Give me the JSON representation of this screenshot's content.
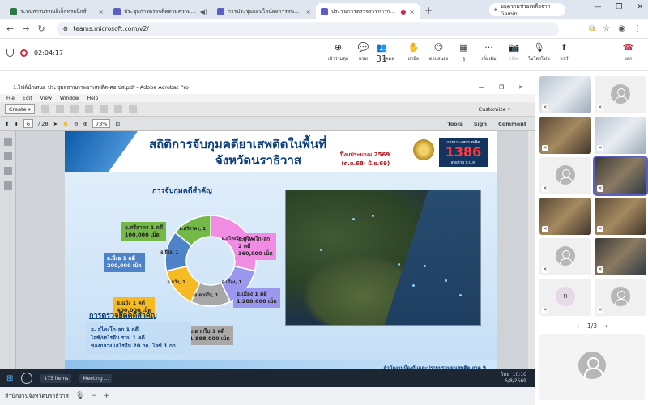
{
  "browser": {
    "tabs": [
      {
        "title": "ระบบสารบรรณอิเล็กทรอนิกส์",
        "color": "#2c7a3f"
      },
      {
        "title": "ประชุมการตรวจติดตามความก้าวหน้า",
        "color": "#5b5fc7"
      },
      {
        "title": "การประชุมออนไลน์ผลการสนทนาฯ",
        "color": "#5b5fc7"
      },
      {
        "title": "ประชุมการตรวจราชการกรมสอบสวน",
        "color": "#5b5fc7"
      }
    ],
    "new_tab_label": "+",
    "gemini_label": "ขอความช่วยเหลือจาก Gemini",
    "url": "teams.microsoft.com/v2/"
  },
  "teams": {
    "timer": "02:04:17",
    "controls": [
      {
        "label": "เข้าร่วมคุย",
        "icon": "⊕",
        "name": "join-chat"
      },
      {
        "label": "แชท",
        "icon": "💬",
        "name": "chat"
      },
      {
        "label": "บุคคล",
        "icon": "👥 31",
        "name": "people"
      },
      {
        "label": "ยกมือ",
        "icon": "✋",
        "name": "raise-hand"
      },
      {
        "label": "ตอบสนอง",
        "icon": "☺",
        "name": "react"
      },
      {
        "label": "ดู",
        "icon": "▦",
        "name": "view"
      },
      {
        "label": "เพิ่มเติม",
        "icon": "···",
        "name": "more"
      },
      {
        "label": "กล้อง",
        "icon": "📷",
        "name": "camera"
      },
      {
        "label": "ไมโครโฟน",
        "icon": "🎙",
        "name": "mic"
      },
      {
        "label": "แชร์",
        "icon": "⬆",
        "name": "share"
      }
    ],
    "leave_label": "ออก",
    "page_indicator": "1/3",
    "tile_letter": "n"
  },
  "acrobat": {
    "window_title": "1.ไฟล์นำเสนอ ประชุมสถานภาพยาเสพติด-ศอ.ปส.pdf - Adobe Acrobat Pro",
    "menu": [
      "File",
      "Edit",
      "View",
      "Window",
      "Help"
    ],
    "create_label": "Create",
    "customize_label": "Customize",
    "page_current": "6",
    "page_total": "/ 28",
    "zoom": "73%",
    "panel_links": [
      "Tools",
      "Sign",
      "Comment"
    ]
  },
  "slide": {
    "title_line1": "สถิติการจับกุมคดียาเสพติดในพื้นที่",
    "title_line2": "จังหวัดนราธิวาส",
    "fiscal_year": "ปีงบประมาณ 2569",
    "fiscal_range": "(ต.ค.68- มิ.ย.69)",
    "hotline_top": "แจ้งเบาะแสยาเสพติด",
    "hotline_number": "1386",
    "hotline_bottom": "สายด่วน ป.ป.ส.",
    "section_arrests": "การจับกุมคดีสำคัญ",
    "section_seizure": "การตรวจยึดคดีสำคัญ",
    "seizure_lines": [
      "อ. สุไหงโก-ลก 1 คดี",
      "ไอซ์/เฮโรอีน รวม 1 คดี",
      "ของกลาง เฮโรอีน 20 กก. ไอซ์ 1 กก."
    ],
    "footer": "สำนักงานป้องกันและปราบปรามยาเสพติด ภาค 9"
  },
  "chart_data": {
    "type": "pie",
    "variant": "donut",
    "title": "การจับกุมคดีสำคัญ",
    "categories": [
      "อ.สุไหงโก-ลก",
      "อ.เมือง",
      "อ.ตากใบ",
      "อ.แว้ง",
      "อ.ยี่งอ",
      "อ.ศรีสาคร"
    ],
    "values": [
      2,
      1,
      1,
      1,
      1,
      1
    ],
    "segment_labels": [
      "อ.สุไหงโก-ลก, 2",
      "อ.เมือง, 1",
      "อ.ตากใบ, 1",
      "อ.แว้ง, 1",
      "อ.ยี่งอ, 1",
      "อ.ศรีสาคร, 1"
    ],
    "callouts": [
      {
        "line1": "อ.สุไหงโก-ลก",
        "line2": "2 คดี",
        "line3": "360,000 เม็ด"
      },
      {
        "line1": "อ.เมือง 1 คดี",
        "line2": "1,288,000 เม็ด"
      },
      {
        "line1": "อ.ตากใบ 1 คดี",
        "line2": "1,898,000 เม็ด"
      },
      {
        "line1": "อ.แว้ง 1 คดี",
        "line2": "400,000 เม็ด"
      },
      {
        "line1": "อ.ยี่งอ 1 คดี",
        "line2": "200,000 เม็ด"
      },
      {
        "line1": "อ.ศรีสาคร 1 คดี",
        "line2": "100,000 เม็ด"
      }
    ],
    "colors": [
      "#f18ce3",
      "#9a98ee",
      "#a8a8a8",
      "#f6bb22",
      "#4f83c9",
      "#74b947"
    ]
  },
  "windows_taskbar": {
    "items": [
      "175 items",
      "Meeting ..."
    ],
    "time": "10:10",
    "date": "6/8/2569",
    "lang": "ไทย"
  },
  "status": {
    "label": "สำนักงานจังหวัดนราธิวาส"
  }
}
